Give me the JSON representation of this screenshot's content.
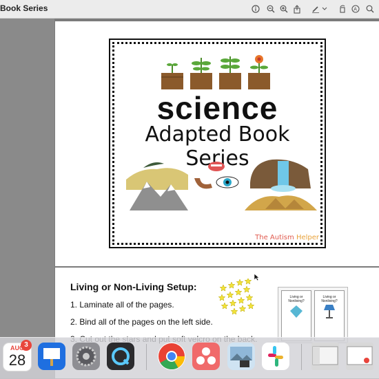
{
  "window": {
    "title": "Book Series"
  },
  "toolbar": {
    "icons": [
      "info-icon",
      "zoom-out-icon",
      "zoom-in-icon",
      "share-icon",
      "markup-pen-icon",
      "markup-dropdown-icon",
      "rotate-icon",
      "annotate-icon",
      "search-icon"
    ]
  },
  "cover": {
    "title": "science",
    "subtitle": "Adapted Book Series",
    "brand_part1": "The Autism",
    "brand_part2": "Helper"
  },
  "setup": {
    "heading": "Living or Non-Living Setup:",
    "steps": [
      "1. Laminate all of the pages.",
      "2. Bind all of the pages on the left side.",
      "3. Cut out the stars and put soft velcro on the back."
    ]
  },
  "thumbs": [
    "Living or Nonliving?",
    "Living or Nonliving?"
  ],
  "dock": {
    "calendar_month": "AUG",
    "calendar_day": "28",
    "calendar_badge": "3",
    "apps": [
      "calendar",
      "keynote",
      "system-settings",
      "quicktime",
      "chrome",
      "asana",
      "preview",
      "slack",
      "finder-window",
      "document-window",
      "app-window"
    ]
  },
  "colors": {
    "accent_red": "#e8453c",
    "cover_brand": "#e05a4e",
    "star": "#f2e23a"
  }
}
